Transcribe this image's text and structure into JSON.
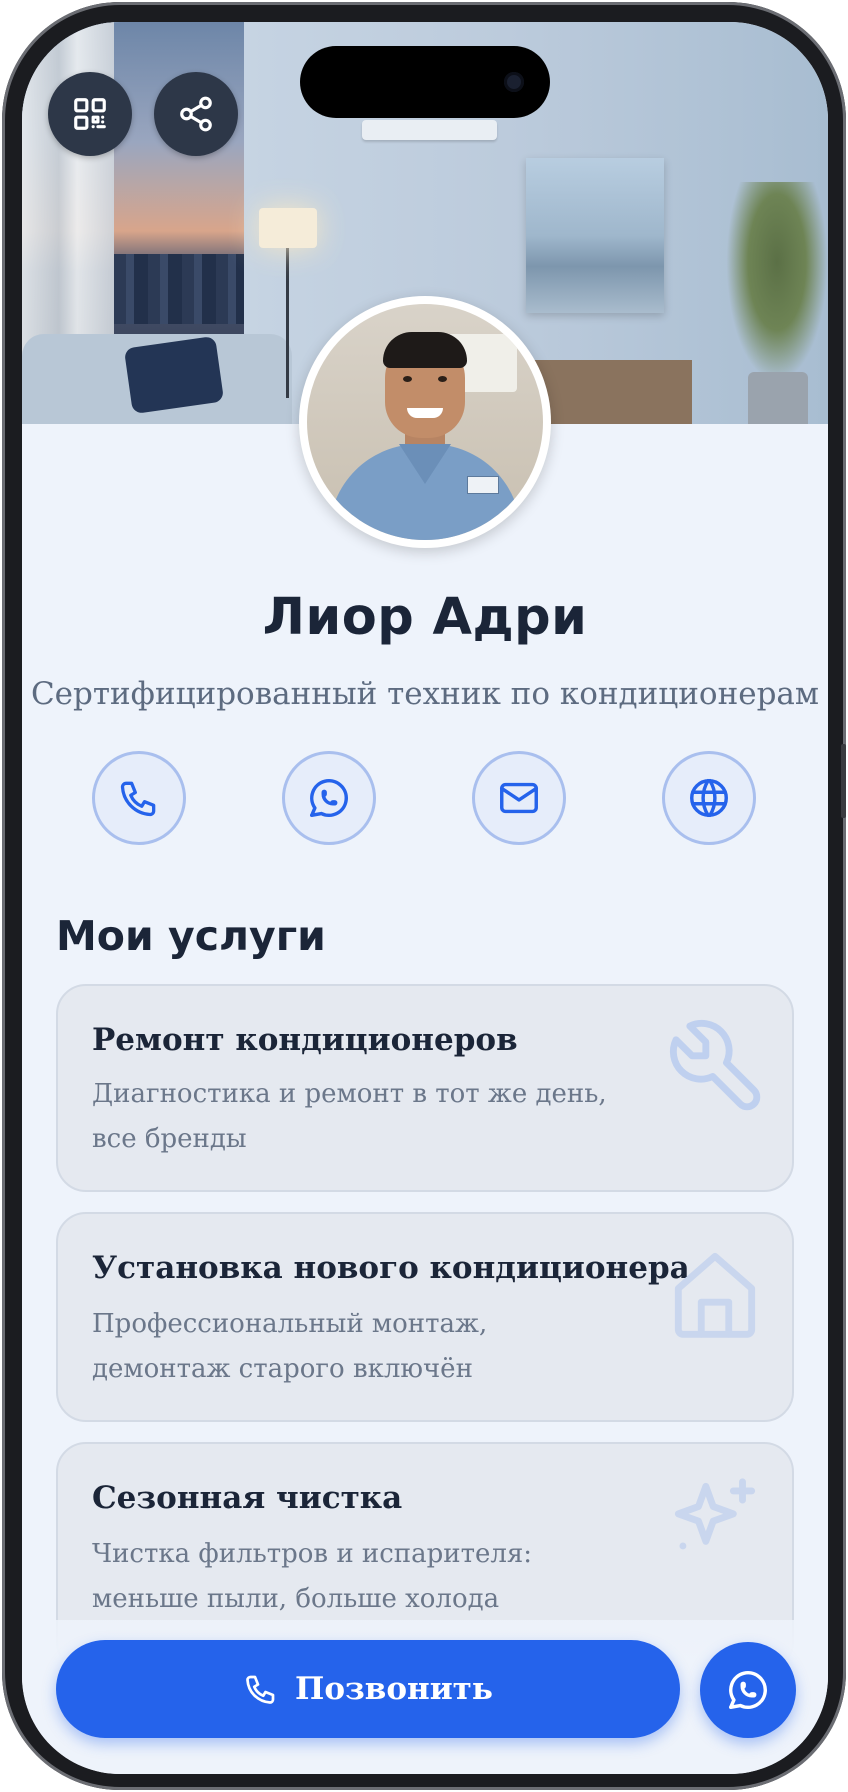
{
  "profile": {
    "name": "Лиор Адри",
    "title": "Сертифицированный техник по кондиционерам"
  },
  "top_actions": [
    {
      "icon": "qr-code-icon"
    },
    {
      "icon": "share-icon"
    }
  ],
  "contacts": [
    {
      "icon": "phone-icon"
    },
    {
      "icon": "whatsapp-icon"
    },
    {
      "icon": "mail-icon"
    },
    {
      "icon": "globe-icon"
    }
  ],
  "services": {
    "heading": "Мои услуги",
    "items": [
      {
        "title": "Ремонт кондиционеров",
        "description": "Диагностика и ремонт в тот же день, все бренды",
        "icon": "wrench-icon"
      },
      {
        "title": "Установка нового кондиционера",
        "description": "Профессиональный монтаж, демонтаж старого включён",
        "icon": "home-icon"
      },
      {
        "title": "Сезонная чистка",
        "description": "Чистка фильтров и испарителя: меньше пыли, больше холода",
        "icon": "sparkles-icon"
      }
    ]
  },
  "bottom": {
    "call_label": "Позвонить",
    "call_icon": "phone-icon",
    "whatsapp_icon": "whatsapp-icon"
  },
  "colors": {
    "accent": "#2563eb",
    "text_dark": "#1b2538",
    "text_muted": "#5d6b80",
    "background": "#eef3fb",
    "card_bg": "#e5e9f0"
  }
}
